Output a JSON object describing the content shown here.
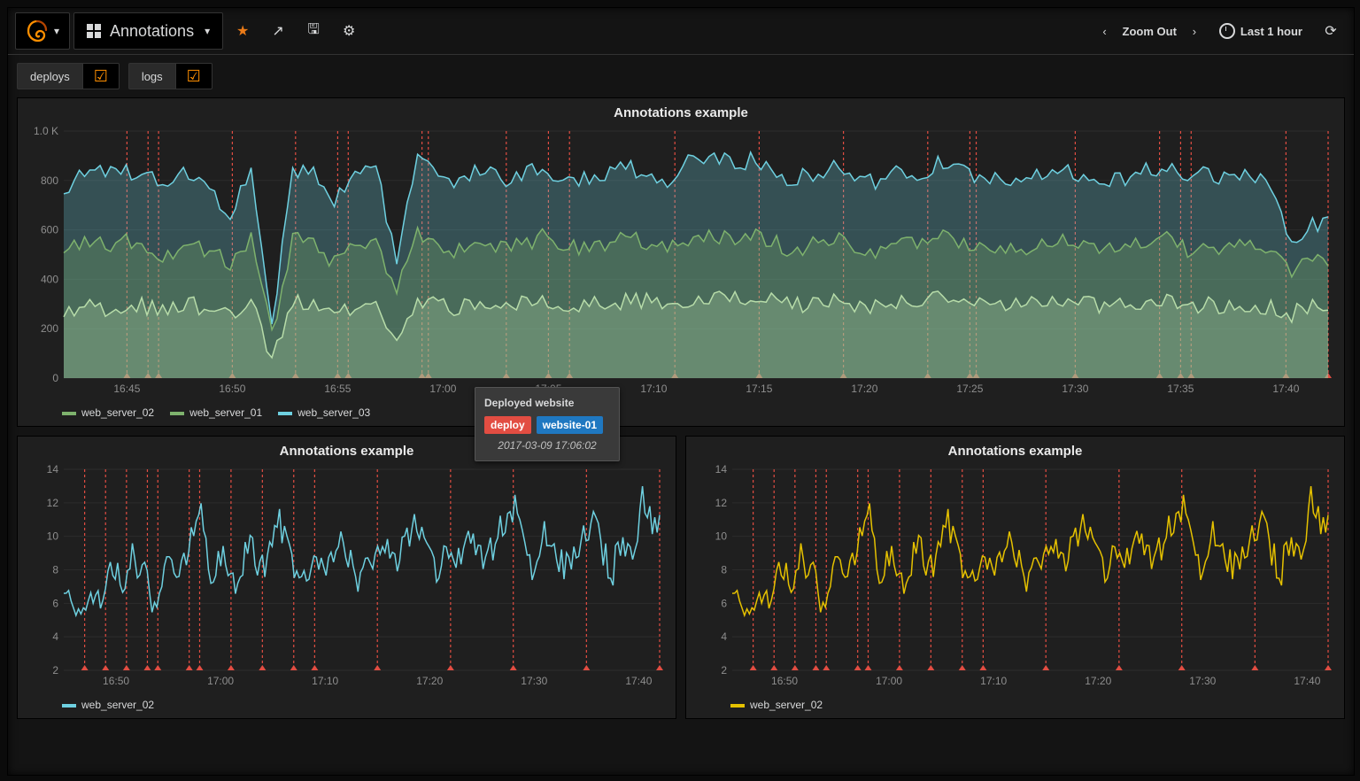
{
  "header": {
    "dashboard_title": "Annotations",
    "zoom_label": "Zoom Out",
    "time_range": "Last 1 hour"
  },
  "annotation_toggles": [
    {
      "name": "deploys",
      "checked": true
    },
    {
      "name": "logs",
      "checked": true
    }
  ],
  "tooltip": {
    "title": "Deployed website",
    "tags": [
      "deploy",
      "website-01"
    ],
    "timestamp": "2017-03-09 17:06:02"
  },
  "panels": {
    "top": {
      "title": "Annotations example",
      "legend": [
        "web_server_02",
        "web_server_01",
        "web_server_03"
      ],
      "legend_colors": [
        "#7eb26d",
        "#7eb26d",
        "#6ed0e0"
      ]
    },
    "bottom_left": {
      "title": "Annotations example",
      "legend": [
        "web_server_02"
      ],
      "legend_colors": [
        "#6ed0e0"
      ]
    },
    "bottom_right": {
      "title": "Annotations example",
      "legend": [
        "web_server_02"
      ],
      "legend_colors": [
        "#e5c100"
      ]
    }
  },
  "chart_data": [
    {
      "id": "top",
      "type": "area",
      "title": "Annotations example",
      "xlabel": "",
      "ylabel": "",
      "ylim": [
        0,
        1000
      ],
      "yticks": [
        0,
        200,
        400,
        600,
        800,
        "1.0 K"
      ],
      "x_range_min": "16:42",
      "x_range_max": "17:42",
      "xticks": [
        "16:45",
        "16:50",
        "16:55",
        "17:00",
        "17:05",
        "17:10",
        "17:15",
        "17:20",
        "17:25",
        "17:30",
        "17:35",
        "17:40"
      ],
      "annotation_times": [
        "16:45",
        "16:46",
        "16:46.5",
        "16:50",
        "16:53",
        "16:55",
        "16:55.5",
        "16:59",
        "16:59.3",
        "17:03",
        "17:05",
        "17:06",
        "17:11",
        "17:15",
        "17:19",
        "17:23",
        "17:25",
        "17:25.3",
        "17:30",
        "17:34",
        "17:35",
        "17:35.5",
        "17:40",
        "17:42"
      ],
      "series": [
        {
          "name": "web_server_03",
          "color": "#6ed0e0",
          "baseline_values_approx": [
            760,
            850,
            820,
            840,
            820,
            800,
            830,
            770,
            650,
            870,
            210,
            850,
            830,
            720,
            820,
            850,
            470,
            920,
            800,
            790,
            850,
            800,
            830,
            860,
            790,
            810,
            830,
            850,
            840,
            800,
            870,
            900,
            870,
            880,
            840,
            800,
            830,
            860,
            830,
            790,
            840,
            820,
            870,
            840,
            800,
            830,
            790,
            820,
            850,
            820,
            790,
            810,
            840,
            860,
            800,
            830,
            790,
            820,
            780,
            560,
            620
          ]
        },
        {
          "name": "web_server_01",
          "color": "#7eb26d",
          "baseline_values_approx": [
            520,
            560,
            540,
            550,
            520,
            500,
            540,
            520,
            470,
            560,
            180,
            560,
            540,
            460,
            540,
            560,
            350,
            580,
            520,
            510,
            560,
            520,
            540,
            570,
            520,
            530,
            540,
            560,
            550,
            520,
            570,
            580,
            570,
            580,
            550,
            520,
            540,
            560,
            540,
            520,
            550,
            540,
            570,
            550,
            520,
            540,
            520,
            540,
            560,
            540,
            520,
            530,
            550,
            560,
            520,
            540,
            520,
            540,
            510,
            430,
            480
          ]
        },
        {
          "name": "web_server_02",
          "color": "#b7dca9",
          "baseline_values_approx": [
            260,
            300,
            280,
            300,
            290,
            270,
            300,
            280,
            260,
            310,
            60,
            310,
            290,
            240,
            300,
            310,
            160,
            320,
            290,
            280,
            310,
            290,
            300,
            320,
            290,
            300,
            300,
            310,
            310,
            290,
            320,
            330,
            320,
            320,
            310,
            290,
            300,
            320,
            300,
            290,
            310,
            300,
            320,
            310,
            290,
            300,
            290,
            300,
            310,
            300,
            290,
            300,
            310,
            320,
            290,
            300,
            290,
            300,
            290,
            260,
            290
          ]
        }
      ]
    },
    {
      "id": "bottom_left",
      "type": "line",
      "title": "Annotations example",
      "ylim": [
        2,
        14
      ],
      "yticks": [
        2,
        4,
        6,
        8,
        10,
        12,
        14
      ],
      "x_range_min": "16:45",
      "x_range_max": "17:42",
      "xticks": [
        "16:50",
        "17:00",
        "17:10",
        "17:20",
        "17:30",
        "17:40"
      ],
      "annotation_times": [
        "16:47",
        "16:49",
        "16:51",
        "16:53",
        "16:54",
        "16:57",
        "16:58",
        "17:01",
        "17:04",
        "17:07",
        "17:09",
        "17:15",
        "17:22",
        "17:28",
        "17:35",
        "17:42"
      ],
      "series": [
        {
          "name": "web_server_02",
          "color": "#6ed0e0",
          "values_approx": [
            7,
            6,
            5,
            7,
            6,
            8,
            7,
            9,
            8,
            6,
            7,
            9,
            8,
            10,
            11,
            8,
            9,
            7,
            8,
            10,
            8,
            9,
            11,
            9,
            7,
            8,
            9,
            8,
            10,
            9,
            7,
            8,
            10,
            9,
            8,
            10,
            11,
            9,
            8,
            9,
            8,
            10,
            9,
            8,
            10,
            11,
            12,
            9,
            8,
            10,
            9,
            8,
            9,
            10,
            11,
            9,
            8,
            10,
            9,
            12,
            11
          ]
        }
      ]
    },
    {
      "id": "bottom_right",
      "type": "line",
      "title": "Annotations example",
      "ylim": [
        2,
        14
      ],
      "yticks": [
        2,
        4,
        6,
        8,
        10,
        12,
        14
      ],
      "x_range_min": "16:45",
      "x_range_max": "17:42",
      "xticks": [
        "16:50",
        "17:00",
        "17:10",
        "17:20",
        "17:30",
        "17:40"
      ],
      "annotation_times": [
        "16:47",
        "16:49",
        "16:51",
        "16:53",
        "16:54",
        "16:57",
        "16:58",
        "17:01",
        "17:04",
        "17:07",
        "17:09",
        "17:15",
        "17:22",
        "17:28",
        "17:35",
        "17:42"
      ],
      "series": [
        {
          "name": "web_server_02",
          "color": "#e5c100",
          "values_approx": [
            7,
            6,
            5,
            7,
            6,
            8,
            7,
            9,
            8,
            6,
            7,
            9,
            8,
            10,
            11,
            8,
            9,
            7,
            8,
            10,
            8,
            9,
            11,
            9,
            7,
            8,
            9,
            8,
            10,
            9,
            7,
            8,
            10,
            9,
            8,
            10,
            11,
            9,
            8,
            9,
            8,
            10,
            9,
            8,
            10,
            11,
            12,
            9,
            8,
            10,
            9,
            8,
            9,
            10,
            11,
            9,
            8,
            10,
            9,
            12,
            11
          ]
        }
      ]
    }
  ]
}
